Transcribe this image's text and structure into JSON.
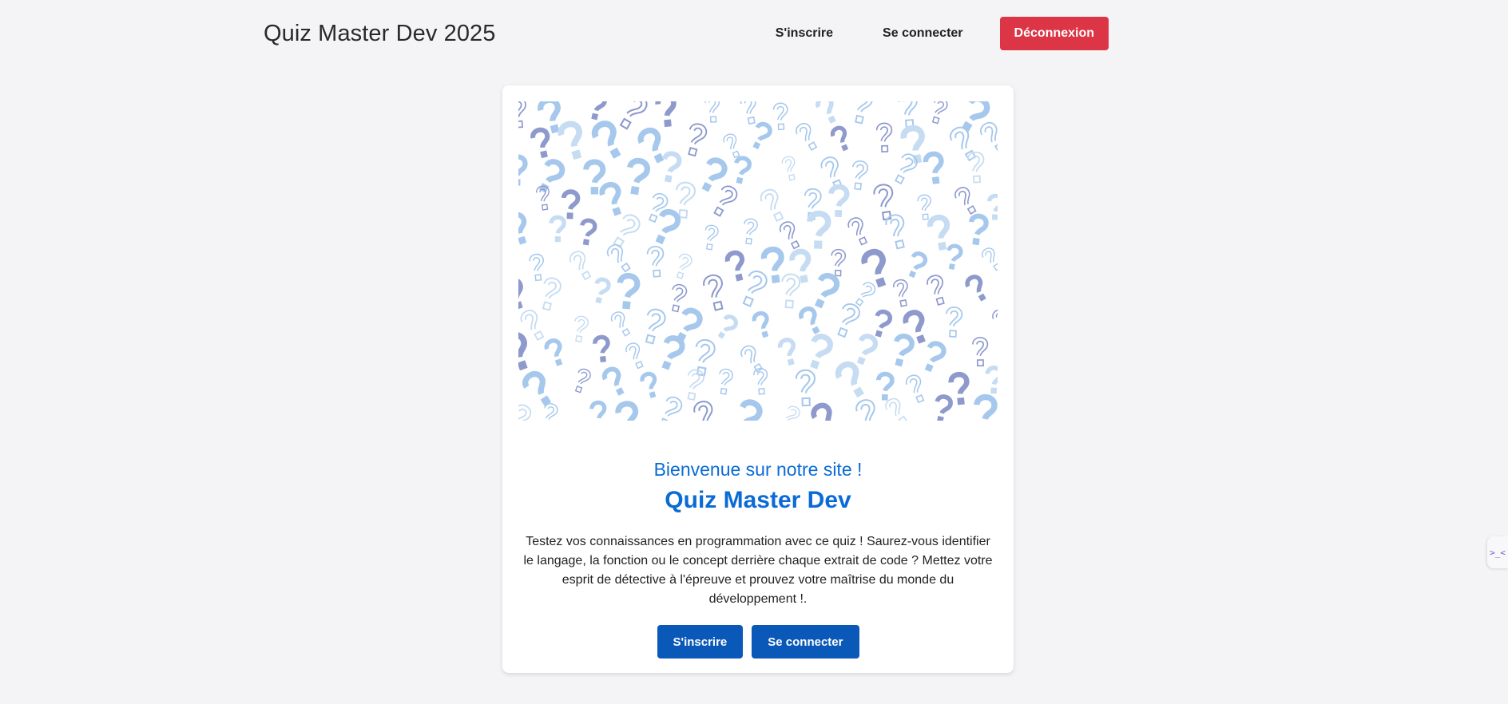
{
  "header": {
    "title": "Quiz Master Dev 2025",
    "nav": {
      "signup": "S'inscrire",
      "login": "Se connecter",
      "logout": "Déconnexion"
    }
  },
  "card": {
    "subtitle": "Bienvenue sur notre site !",
    "title": "Quiz Master Dev",
    "description": "Testez vos connaissances en programmation avec ce quiz ! Saurez-vous identifier le langage, la fonction ou le concept derrière chaque extrait de code ? Mettez votre esprit de détective à l'épreuve et prouvez votre maîtrise du monde du développement !.",
    "buttons": {
      "signup": "S'inscrire",
      "login": "Se connecter"
    },
    "hero_icon": "question-marks-pattern"
  },
  "side_tab": {
    "icon": "code-icon",
    "text": ">_<"
  },
  "colors": {
    "accent": "#0b6bd6",
    "primary_button": "#0a58b8",
    "danger_button": "#dc3545",
    "background": "#f4f4f6",
    "pattern_dark": "#8e99cc",
    "pattern_light": "#a6c8ec",
    "pattern_pale": "#c6dcf2"
  }
}
